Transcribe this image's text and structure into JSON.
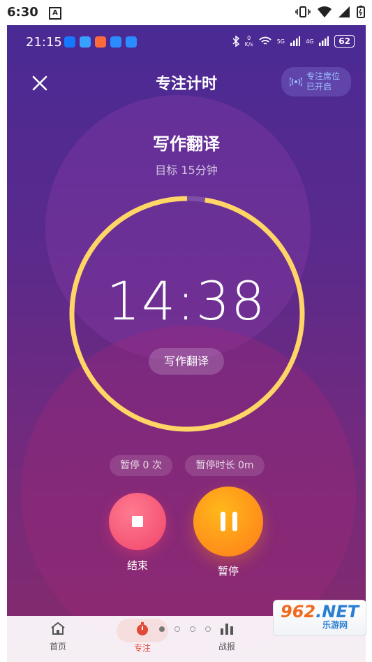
{
  "os_status": {
    "time": "6:30",
    "a_label": "A"
  },
  "inner_status": {
    "time": "21:15",
    "net_speed_top": "0",
    "net_speed_bottom": "K/s",
    "net_5g": "5G",
    "net_4g": "4G",
    "battery": "62"
  },
  "header": {
    "title": "专注计时",
    "seat_line1": "专注席位",
    "seat_line2": "已开启"
  },
  "task": {
    "title": "写作翻译",
    "goal": "目标 15分钟"
  },
  "timer": {
    "value": "14:38",
    "chip": "写作翻译",
    "progress": 0.975
  },
  "stats": {
    "pause_count": "暂停 0 次",
    "pause_duration": "暂停时长 0m"
  },
  "controls": {
    "end_label": "结束",
    "pause_label": "暂停"
  },
  "nav": {
    "items": [
      {
        "label": "首页",
        "icon": "home-icon"
      },
      {
        "label": "专注",
        "icon": "stopwatch-icon"
      },
      {
        "label": "战报",
        "icon": "bar-chart-icon"
      }
    ]
  },
  "watermark": {
    "big_left": "962",
    "big_right": ".NET",
    "small": "乐游网"
  },
  "colors": {
    "ring": "#ffd566",
    "end": "#f0456b",
    "pause": "#ff8f1a",
    "accent": "#e04a38"
  }
}
